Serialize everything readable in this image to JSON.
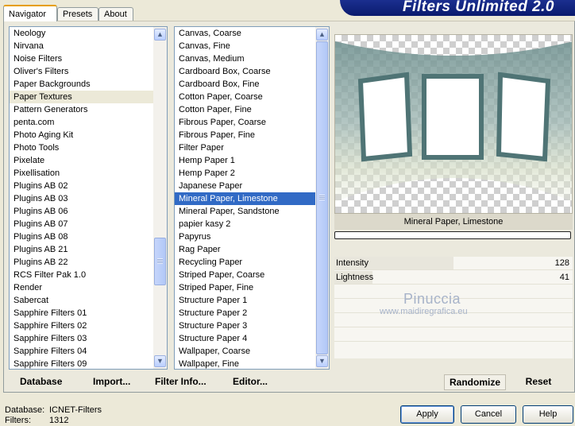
{
  "header": {
    "title": "Filters Unlimited 2.0"
  },
  "tabs": [
    {
      "label": "Navigator",
      "active": true
    },
    {
      "label": "Presets",
      "active": false
    },
    {
      "label": "About",
      "active": false
    }
  ],
  "categories": {
    "items": [
      "Neology",
      "Nirvana",
      "Noise Filters",
      "Oliver's Filters",
      "Paper Backgrounds",
      "Paper Textures",
      "Pattern Generators",
      "penta.com",
      "Photo Aging Kit",
      "Photo Tools",
      "Pixelate",
      "Pixellisation",
      "Plugins AB 02",
      "Plugins AB 03",
      "Plugins AB 06",
      "Plugins AB 07",
      "Plugins AB 08",
      "Plugins AB 21",
      "Plugins AB 22",
      "RCS Filter Pak 1.0",
      "Render",
      "Sabercat",
      "Sapphire Filters 01",
      "Sapphire Filters 02",
      "Sapphire Filters 03",
      "Sapphire Filters 04",
      "Sapphire Filters 09"
    ],
    "selected": "Paper Textures",
    "scroll_fraction": 0.74
  },
  "filters": {
    "items": [
      "Canvas, Coarse",
      "Canvas, Fine",
      "Canvas, Medium",
      "Cardboard Box, Coarse",
      "Cardboard Box, Fine",
      "Cotton Paper, Coarse",
      "Cotton Paper, Fine",
      "Fibrous Paper, Coarse",
      "Fibrous Paper, Fine",
      "Filter Paper",
      "Hemp Paper 1",
      "Hemp Paper 2",
      "Japanese Paper",
      "Mineral Paper, Limestone",
      "Mineral Paper, Sandstone",
      "papier kasy 2",
      "Papyrus",
      "Rag Paper",
      "Recycling Paper",
      "Striped Paper, Coarse",
      "Striped Paper, Fine",
      "Structure Paper 1",
      "Structure Paper 2",
      "Structure Paper 3",
      "Structure Paper 4",
      "Wallpaper, Coarse",
      "Wallpaper, Fine"
    ],
    "selected": "Mineral Paper, Limestone"
  },
  "panel_buttons": {
    "database": "Database",
    "import": "Import...",
    "filter_info": "Filter Info...",
    "editor": "Editor..."
  },
  "preview": {
    "filter_name": "Mineral Paper, Limestone",
    "progress": 0
  },
  "params": [
    {
      "label": "Intensity",
      "value": "128",
      "level": 0.5
    },
    {
      "label": "Lightness",
      "value": "41",
      "level": 0.16
    }
  ],
  "watermark": {
    "line1": "Pinuccia",
    "line2": "www.maidiregrafica.eu"
  },
  "action_buttons": {
    "randomize": "Randomize",
    "reset": "Reset"
  },
  "status": {
    "database_label": "Database:",
    "database_value": "ICNET-Filters",
    "filters_label": "Filters:",
    "filters_value": "1312"
  },
  "dialog_buttons": {
    "apply": "Apply",
    "cancel": "Cancel",
    "help": "Help"
  },
  "colors": {
    "selection": "#316ac5",
    "banner": "#0a1a6e",
    "accent": "#e69e00"
  }
}
